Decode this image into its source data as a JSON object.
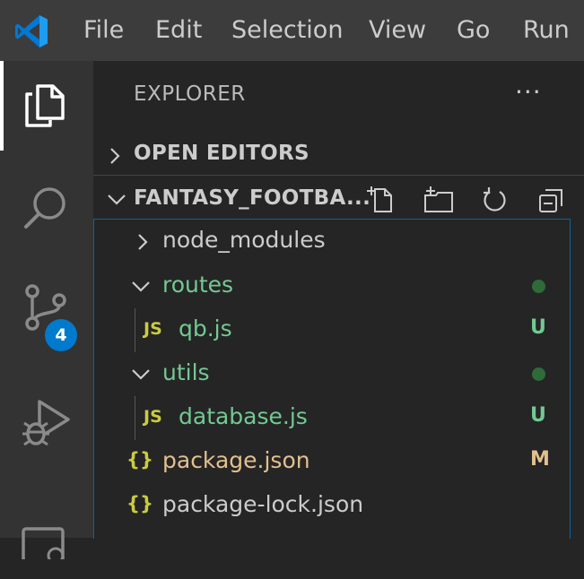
{
  "menu": {
    "items": [
      "File",
      "Edit",
      "Selection",
      "View",
      "Go",
      "Run"
    ]
  },
  "activity_bar": {
    "scm_badge": "4"
  },
  "explorer": {
    "title": "EXPLORER",
    "more_actions": "···",
    "open_editors_label": "OPEN EDITORS",
    "project_label": "FANTASY_FOOTBA..."
  },
  "tree": [
    {
      "name": "node_modules",
      "kind": "folder",
      "expanded": false,
      "status": ""
    },
    {
      "name": "routes",
      "kind": "folder",
      "expanded": true,
      "status": "dot"
    },
    {
      "name": "qb.js",
      "kind": "js",
      "icon_text": "JS",
      "status": "U"
    },
    {
      "name": "utils",
      "kind": "folder",
      "expanded": true,
      "status": "dot"
    },
    {
      "name": "database.js",
      "kind": "js",
      "icon_text": "JS",
      "status": "U"
    },
    {
      "name": "package.json",
      "kind": "json",
      "icon_text": "{}",
      "status": "M"
    },
    {
      "name": "package-lock.json",
      "kind": "json",
      "icon_text": "{}",
      "status": ""
    }
  ],
  "colors": {
    "untracked": "#73c991",
    "modified": "#e2c08d",
    "focus_border": "#0e639c",
    "badge": "#007acc"
  }
}
